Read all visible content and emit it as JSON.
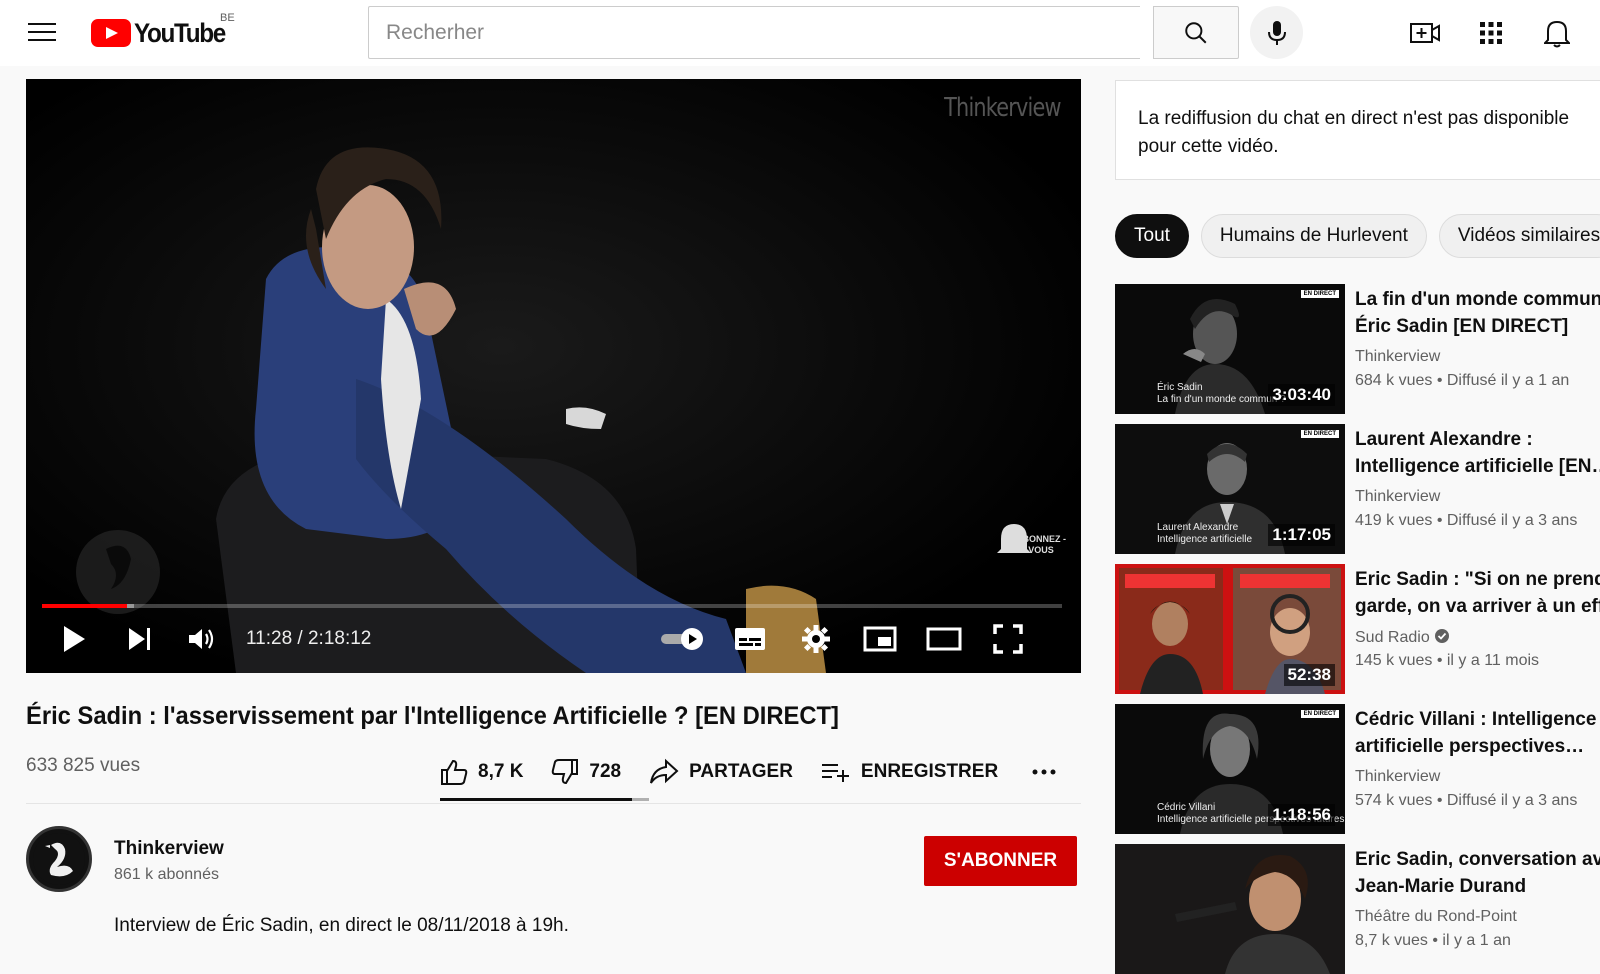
{
  "header": {
    "logo_text": "YouTube",
    "country_code": "BE",
    "search_placeholder": "Recherher",
    "icons": [
      "menu-icon",
      "search-icon",
      "mic-icon",
      "create-video-icon",
      "apps-grid-icon",
      "notifications-bell-icon"
    ]
  },
  "player": {
    "watermark": "Thinkerview",
    "subscribe_overlay": "ABONNEZ -VOUS",
    "current_time": "11:28",
    "duration": "2:18:12",
    "time_label": "11:28 / 2:18:12",
    "progress_played": 0.083,
    "progress_buffered": 0.09
  },
  "video": {
    "title": "Éric Sadin : l'asservissement par l'Intelligence Artificielle ? [EN DIRECT]",
    "views": "633 825 vues",
    "likes": "8,7 K",
    "dislikes": "728",
    "share_label": "PARTAGER",
    "save_label": "ENREGISTRER",
    "like_ratio": 0.92
  },
  "channel": {
    "name": "Thinkerview",
    "subscribers": "861 k abonnés",
    "subscribe_label": "S'ABONNER",
    "description": "Interview de Éric Sadin, en direct le 08/11/2018 à 19h."
  },
  "chat": {
    "message": "La rediffusion du chat en direct n'est pas disponible pour cette vidéo."
  },
  "chips": [
    {
      "label": "Tout",
      "active": true
    },
    {
      "label": "Humains de Hurlevent",
      "active": false
    },
    {
      "label": "Vidéos similaires",
      "active": false
    }
  ],
  "recommendations": [
    {
      "title_line1": "La fin d'un monde commun ?",
      "title_line2": "Éric Sadin [EN DIRECT]",
      "channel": "Thinkerview",
      "meta": "684 k vues • Diffusé il y a 1 an",
      "duration": "3:03:40",
      "badge": "EN DIRECT",
      "thumb_text_1": "Éric Sadin",
      "thumb_text_2": "La fin d'un monde commun ?",
      "verified": false
    },
    {
      "title_line1": "Laurent Alexandre :",
      "title_line2": "Intelligence artificielle [EN…",
      "channel": "Thinkerview",
      "meta": "419 k vues • Diffusé il y a 3 ans",
      "duration": "1:17:05",
      "badge": "EN DIRECT",
      "thumb_text_1": "Laurent Alexandre",
      "thumb_text_2": "Intelligence artificielle",
      "verified": false
    },
    {
      "title_line1": "Eric Sadin : \"Si on ne prend pas",
      "title_line2": "garde, on va arriver à un effondre…",
      "channel": "Sud Radio",
      "meta": "145 k vues • il y a 11 mois",
      "duration": "52:38",
      "badge": "",
      "thumb_text_1": "",
      "thumb_text_2": "",
      "verified": true
    },
    {
      "title_line1": "Cédric Villani : Intelligence",
      "title_line2": "artificielle perspectives…",
      "channel": "Thinkerview",
      "meta": "574 k vues • Diffusé il y a 3 ans",
      "duration": "1:18:56",
      "badge": "EN DIRECT",
      "thumb_text_1": "Cédric Villani",
      "thumb_text_2": "Intelligence artificielle perspectives futures",
      "verified": false
    },
    {
      "title_line1": "Eric Sadin, conversation avec",
      "title_line2": "Jean-Marie Durand",
      "channel": "Théâtre du Rond-Point",
      "meta": "8,7 k vues • il y a 1 an",
      "duration": "",
      "badge": "",
      "thumb_text_1": "",
      "thumb_text_2": "",
      "verified": false
    }
  ]
}
